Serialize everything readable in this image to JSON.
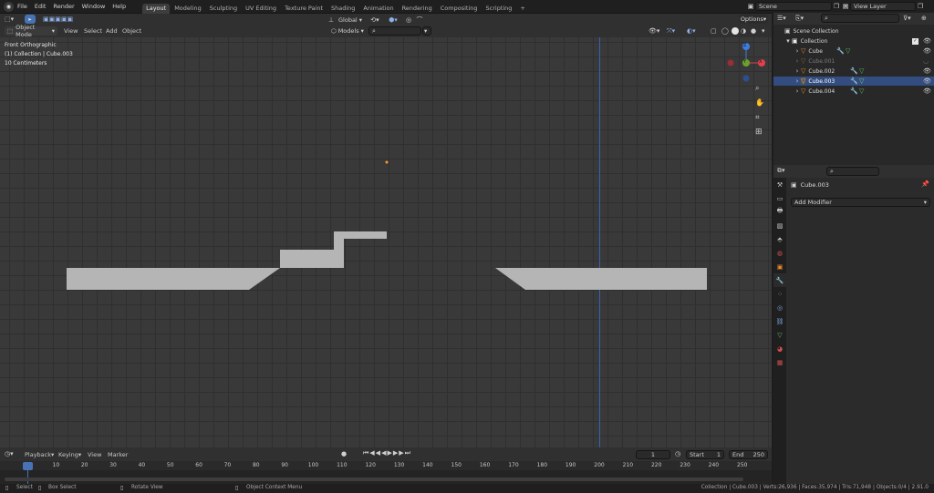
{
  "topbar": {
    "menu": [
      "File",
      "Edit",
      "Render",
      "Window",
      "Help"
    ],
    "workspaces": [
      "Layout",
      "Modeling",
      "Sculpting",
      "UV Editing",
      "Texture Paint",
      "Shading",
      "Animation",
      "Rendering",
      "Compositing",
      "Scripting"
    ],
    "active_workspace": "Layout",
    "add_tab": "+",
    "scene": "Scene",
    "view_layer": "View Layer"
  },
  "tool_header": {
    "orientation": "Global",
    "options": "Options"
  },
  "viewport_header": {
    "mode": "Object Mode",
    "menus": [
      "View",
      "Select",
      "Add",
      "Object"
    ],
    "models_select": "Models"
  },
  "overlay_text": {
    "view_name": "Front Orthographic",
    "collection": "(1) Collection | Cube.003",
    "scale": "10 Centimeters"
  },
  "gizmo": {
    "z": "Z",
    "y": "Y",
    "x": "X"
  },
  "outliner": {
    "root": "Scene Collection",
    "collection": "Collection",
    "items": [
      {
        "name": "Cube",
        "dim": false
      },
      {
        "name": "Cube.001",
        "dim": true
      },
      {
        "name": "Cube.002",
        "dim": false
      },
      {
        "name": "Cube.003",
        "dim": false,
        "selected": true
      },
      {
        "name": "Cube.004",
        "dim": false
      }
    ]
  },
  "properties": {
    "object_name": "Cube.003",
    "add_modifier": "Add Modifier"
  },
  "timeline": {
    "menus": [
      "Playback",
      "Keying",
      "View",
      "Marker"
    ],
    "current_frame": "1",
    "start_label": "Start",
    "start": "1",
    "end_label": "End",
    "end": "250",
    "ruler": [
      1,
      10,
      20,
      30,
      40,
      50,
      60,
      70,
      80,
      90,
      100,
      110,
      120,
      130,
      140,
      150,
      160,
      170,
      180,
      190,
      200,
      210,
      220,
      230,
      240,
      250
    ]
  },
  "statusbar": {
    "select": "Select",
    "box_select": "Box Select",
    "rotate_view": "Rotate View",
    "context_menu": "Object Context Menu",
    "stats": "Collection | Cube.003 | Verts:26,936 | Faces:35,974 | Tris:71,948 | Objects:0/4 | 2.91.0"
  },
  "colors": {
    "accent": "#4772b3",
    "active_tab": "#3d3d3d",
    "mesh": "#b5b5b5",
    "axis_x": "#e0414d",
    "axis_y": "#6ca12c",
    "axis_z": "#3e7ce0",
    "mesh_icon": "#e98a2f"
  }
}
